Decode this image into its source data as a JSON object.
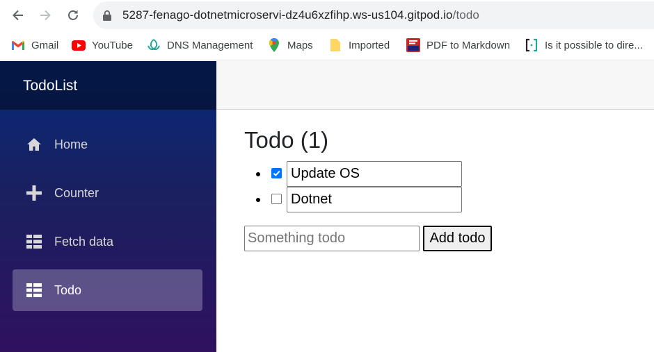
{
  "browser": {
    "url_host": "5287-fenago-dotnetmicroservi-dz4u6xzfihp.ws-us104.gitpod.io",
    "url_path": "/todo",
    "bookmarks": [
      {
        "label": "Gmail",
        "icon": "gmail-icon"
      },
      {
        "label": "YouTube",
        "icon": "youtube-icon"
      },
      {
        "label": "DNS Management",
        "icon": "dns-icon"
      },
      {
        "label": "Maps",
        "icon": "maps-icon"
      },
      {
        "label": "Imported",
        "icon": "folder-icon"
      },
      {
        "label": "PDF to Markdown",
        "icon": "pdf-icon"
      },
      {
        "label": "Is it possible to dire...",
        "icon": "bracket-icon"
      }
    ]
  },
  "app": {
    "brand": "TodoList",
    "nav": [
      {
        "label": "Home",
        "icon": "home-icon",
        "active": false
      },
      {
        "label": "Counter",
        "icon": "plus-icon",
        "active": false
      },
      {
        "label": "Fetch data",
        "icon": "list-icon",
        "active": false
      },
      {
        "label": "Todo",
        "icon": "list-icon",
        "active": true
      }
    ]
  },
  "page": {
    "title": "Todo (1)",
    "todos": [
      {
        "title": "Update OS",
        "done": true
      },
      {
        "title": "Dotnet",
        "done": false
      }
    ],
    "new_todo_placeholder": "Something todo",
    "add_button": "Add todo"
  },
  "colors": {
    "sidebar_top": "#062a7a",
    "sidebar_bottom": "#2f1160",
    "checkbox_checked": "#0075ff"
  }
}
